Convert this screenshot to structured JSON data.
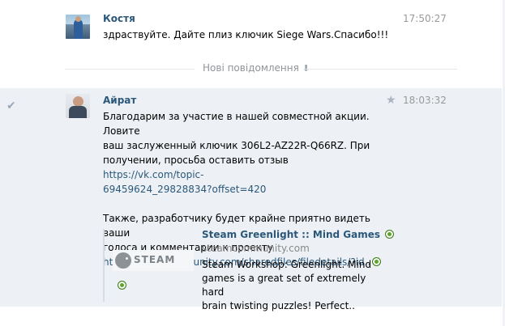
{
  "messages": [
    {
      "author": "Костя",
      "time": "17:50:27",
      "text": "здраствуйте. Дайте плиз ключик Siege Wars.Спасибо!!!"
    },
    {
      "author": "Айрат",
      "time": "18:03:32",
      "lines": [
        "Благодарим за участие в нашей совместной акции. Ловите",
        "ваш заслуженный ключик 306L2-AZ22R-Q66RZ. При",
        "получении, просьба оставить отзыв"
      ],
      "link1_part1": "https://vk.com/topic-",
      "link1_part2": "69459624_29828834?offset=420",
      "lines2": [
        "Также, разработчику будет крайне приятно видеть ваши",
        "голоса и комментарии к проекту"
      ],
      "link2": "http://steamcommunity.com/sharedfiles/filedetails/?id.."
    }
  ],
  "divider": {
    "label": "Нові повідомлення"
  },
  "attachment": {
    "title": "Steam Greenlight :: Mind Games",
    "domain": "steamcommunity.com",
    "desc_lines": [
      "Steam Workshop: Greenlight. Mind",
      "games is a great set of extremely hard",
      "brain twisting puzzles! Perfect.."
    ],
    "thumb_text": "STEAM"
  },
  "colors": {
    "selected_bg": "#edf1f5",
    "link": "#2b587a",
    "muted": "#999999"
  },
  "icons": [
    "check-icon",
    "star-icon",
    "arrow-down-icon",
    "external-link-icon"
  ]
}
